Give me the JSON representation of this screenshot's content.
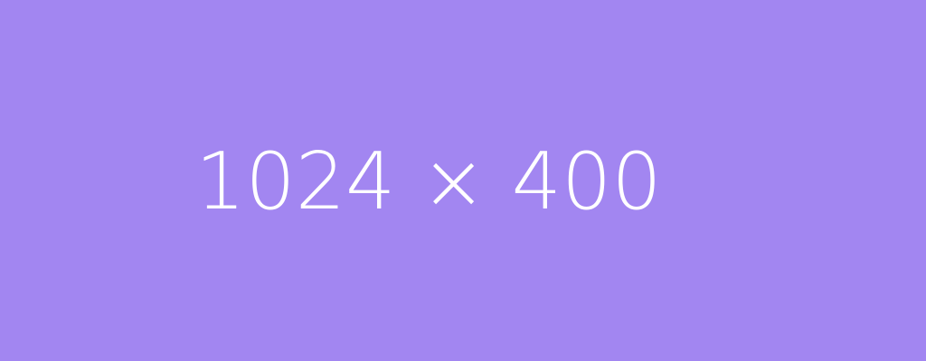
{
  "colors": {
    "background": "#a286f1",
    "text": "#ffffff"
  },
  "placeholder": {
    "label": "1024 × 400"
  }
}
